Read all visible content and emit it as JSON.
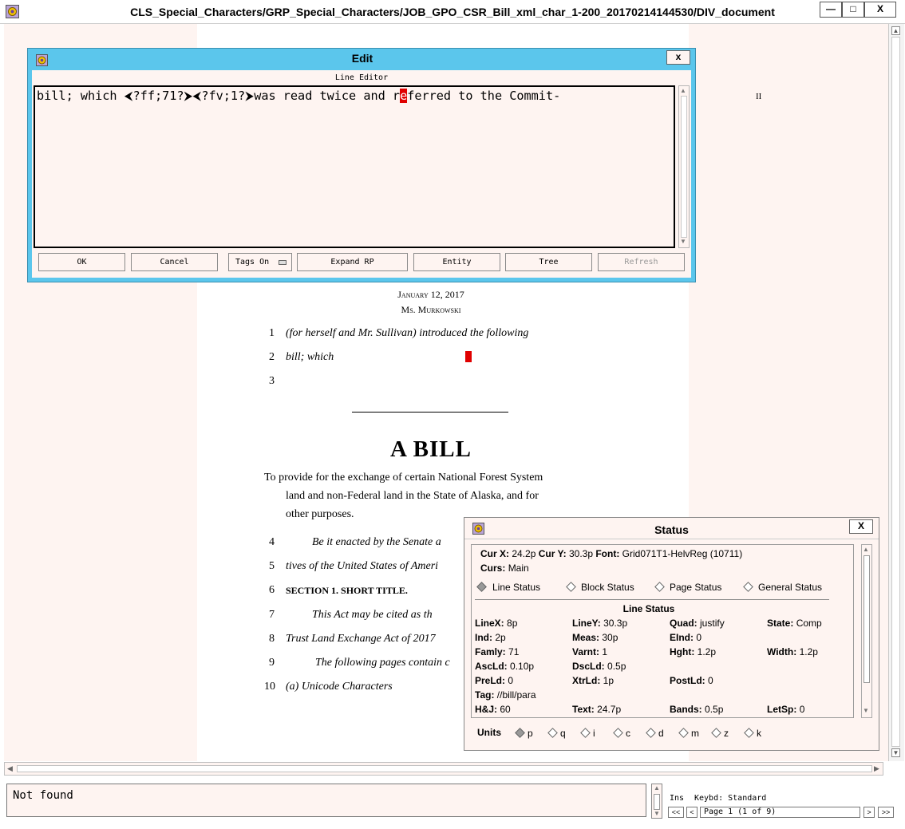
{
  "window": {
    "title": "CLS_Special_Characters/GRP_Special_Characters/JOB_GPO_CSR_Bill_xml_char_1-200_20170214144530/DIV_document",
    "minimize": "—",
    "maximize": "□",
    "close": "X"
  },
  "document": {
    "page_mark": "II",
    "date": "January 12, 2017",
    "sponsor": "Ms. Murkowski",
    "lines": [
      {
        "num": "1",
        "text": "(for herself and Mr. Sullivan) introduced the following"
      },
      {
        "num": "2",
        "text": "bill; which"
      },
      {
        "num": "3",
        "text": ""
      }
    ],
    "heading": "A BILL",
    "purpose_1": "To provide for the exchange of certain National Forest System",
    "purpose_2": "land and non-Federal land in the State of Alaska, and for",
    "purpose_3": "other purposes.",
    "body_lines": [
      {
        "num": "4",
        "text": "Be it enacted by the Senate a"
      },
      {
        "num": "5",
        "text": "tives of the United States of Ameri"
      },
      {
        "num": "6",
        "text": "SECTION 1. SHORT TITLE."
      },
      {
        "num": "7",
        "text": "This Act may be cited as th"
      },
      {
        "num": "8",
        "text": "Trust Land Exchange Act of 2017"
      },
      {
        "num": "9",
        "text": "The following pages contain c"
      },
      {
        "num": "10",
        "text": "(a) Unicode Characters"
      }
    ]
  },
  "edit_dialog": {
    "title": "Edit",
    "close": "x",
    "section": "Line Editor",
    "line_before_cursor": "bill; which ",
    "ctrl_glyph_1": "⮜",
    "seg1": "?ff;71?",
    "ctrl_glyph_2": "⮞",
    "ctrl_glyph_3": "⮜",
    "seg2": "?fv;1?",
    "ctrl_glyph_4": "⮞",
    "seg3": "was read twice and r",
    "cursor_char": "e",
    "seg4": "ferred to the Commit-",
    "buttons": {
      "ok": "OK",
      "cancel": "Cancel",
      "tags": "Tags On",
      "expand": "Expand RP",
      "entity": "Entity",
      "tree": "Tree",
      "refresh": "Refresh"
    }
  },
  "status_dialog": {
    "title": "Status",
    "close": "X",
    "cur_x_label": "Cur X:",
    "cur_x": "24.2p",
    "cur_y_label": "Cur Y:",
    "cur_y": "30.3p",
    "font_label": "Font:",
    "font": "Grid071T1-HelvReg (10711)",
    "curs_label": "Curs:",
    "curs": "Main",
    "tabs": [
      "Line Status",
      "Block Status",
      "Page Status",
      "General Status"
    ],
    "section_title": "Line Status",
    "fields": [
      [
        {
          "k": "LineX:",
          "v": "8p"
        },
        {
          "k": "LineY:",
          "v": "30.3p"
        },
        {
          "k": "Quad:",
          "v": "justify"
        },
        {
          "k": "State:",
          "v": "Comp"
        }
      ],
      [
        {
          "k": "Ind:",
          "v": "2p"
        },
        {
          "k": "Meas:",
          "v": "30p"
        },
        {
          "k": "EInd:",
          "v": "0"
        },
        {
          "k": "",
          "v": ""
        }
      ],
      [
        {
          "k": "Famly:",
          "v": "71"
        },
        {
          "k": "Varnt:",
          "v": "1"
        },
        {
          "k": "Hght:",
          "v": "1.2p"
        },
        {
          "k": "Width:",
          "v": "1.2p"
        }
      ],
      [
        {
          "k": "AscLd:",
          "v": "0.10p"
        },
        {
          "k": "DscLd:",
          "v": "0.5p"
        },
        {
          "k": "",
          "v": ""
        },
        {
          "k": "",
          "v": ""
        }
      ],
      [
        {
          "k": "PreLd:",
          "v": "0"
        },
        {
          "k": "XtrLd:",
          "v": "1p"
        },
        {
          "k": "PostLd:",
          "v": "0"
        },
        {
          "k": "",
          "v": ""
        }
      ]
    ],
    "tag_label": "Tag:",
    "tag": "//bill/para",
    "hj_label": "H&J:",
    "hj": "60",
    "text_label": "Text:",
    "text": "24.7p",
    "bands_label": "Bands:",
    "bands": "0.5p",
    "letsp_label": "LetSp:",
    "letsp": "0",
    "units_label": "Units",
    "units": [
      "p",
      "q",
      "i",
      "c",
      "d",
      "m",
      "z",
      "k"
    ]
  },
  "bottom": {
    "message": "Not found",
    "ins": "Ins",
    "keybd": "Keybd: Standard",
    "page_label": "Page 1 (1 of 9)",
    "first": "<<",
    "prev": "<",
    "next": ">",
    "last": ">>"
  }
}
